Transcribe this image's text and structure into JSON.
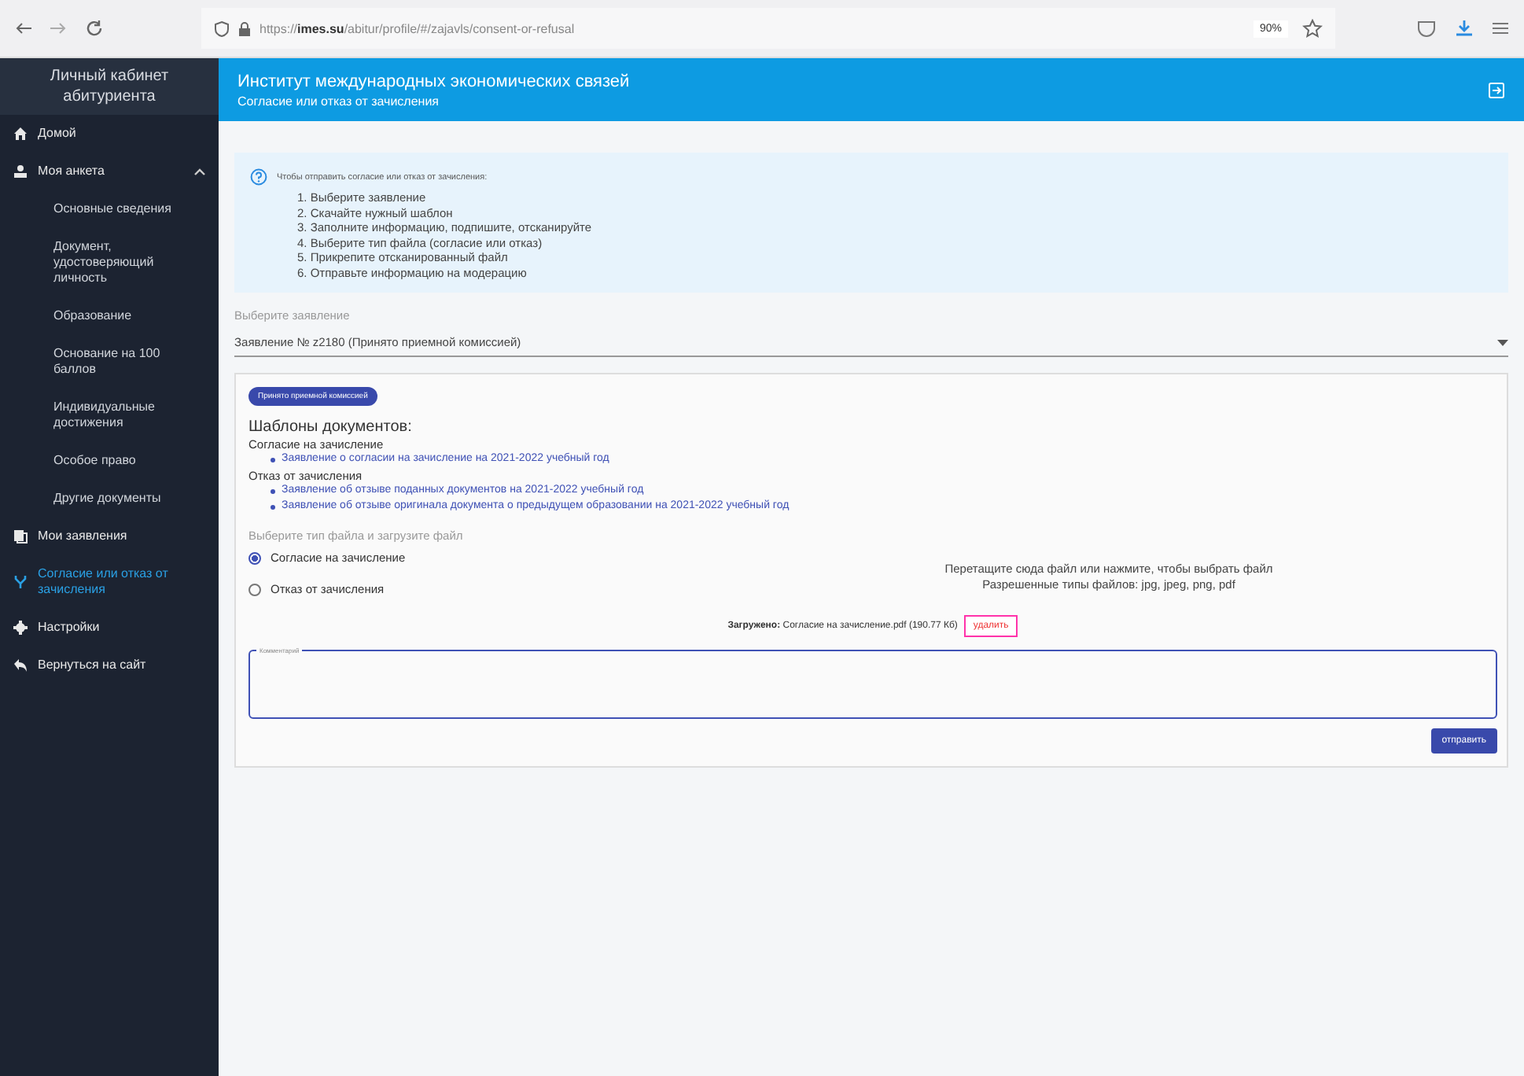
{
  "browser": {
    "url_prefix": "https://",
    "url_domain": "imes.su",
    "url_path": "/abitur/profile/#/zajavls/consent-or-refusal",
    "zoom": "90%"
  },
  "sidebar": {
    "title": "Личный кабинет абитуриента",
    "items": [
      {
        "label": "Домой",
        "selected": false
      },
      {
        "label": "Моя анкета",
        "selected": false,
        "expanded": true,
        "children": [
          {
            "label": "Основные сведения"
          },
          {
            "label": "Документ, удостоверяющий личность"
          },
          {
            "label": "Образование"
          },
          {
            "label": "Основание на 100 баллов"
          },
          {
            "label": "Индивидуальные достижения"
          },
          {
            "label": "Особое право"
          },
          {
            "label": "Другие документы"
          }
        ]
      },
      {
        "label": "Мои заявления",
        "selected": false
      },
      {
        "label": "Согласие или отказ от зачисления",
        "selected": true
      },
      {
        "label": "Настройки",
        "selected": false
      },
      {
        "label": "Вернуться на сайт",
        "selected": false
      }
    ]
  },
  "header": {
    "title": "Институт международных экономических связей",
    "subtitle": "Согласие или отказ от зачисления"
  },
  "info": {
    "intro": "Чтобы отправить согласие или отказ от зачисления:",
    "steps": [
      "1. Выберите заявление",
      "2. Скачайте нужный шаблон",
      "3. Заполните информацию, подпишите, отсканируйте",
      "4. Выберите тип файла (согласие или отказ)",
      "5. Прикрепите отсканированный файл",
      "6. Отправьте информацию на модерацию"
    ]
  },
  "application_select": {
    "label": "Выберите заявление",
    "value": "Заявление № z2180  (Принято приемной комиссией)"
  },
  "status_badge": "Принято приемной комиссией",
  "templates": {
    "title": "Шаблоны документов:",
    "groups": [
      {
        "title": "Согласие на зачисление",
        "links": [
          "Заявление о согласии на зачисление на 2021-2022 учебный год"
        ]
      },
      {
        "title": "Отказ от зачисления",
        "links": [
          "Заявление об отзыве поданных документов на 2021-2022 учебный год",
          "Заявление об отзыве оригинала документа о предыдущем образовании на 2021-2022 учебный год"
        ]
      }
    ]
  },
  "file_type": {
    "label": "Выберите тип файла и загрузите файл",
    "options": [
      {
        "label": "Согласие на зачисление",
        "selected": true
      },
      {
        "label": "Отказ от зачисления",
        "selected": false
      }
    ]
  },
  "dropzone": {
    "line1": "Перетащите сюда файл или нажмите, чтобы выбрать файл",
    "line2": "Разрешенные типы файлов: jpg, jpeg, png, pdf"
  },
  "uploaded": {
    "label": "Загружено:",
    "file": "Согласие на зачисление.pdf (190.77 Кб)",
    "delete": "удалить"
  },
  "comment": {
    "label": "Комментарий"
  },
  "submit": "отправить"
}
